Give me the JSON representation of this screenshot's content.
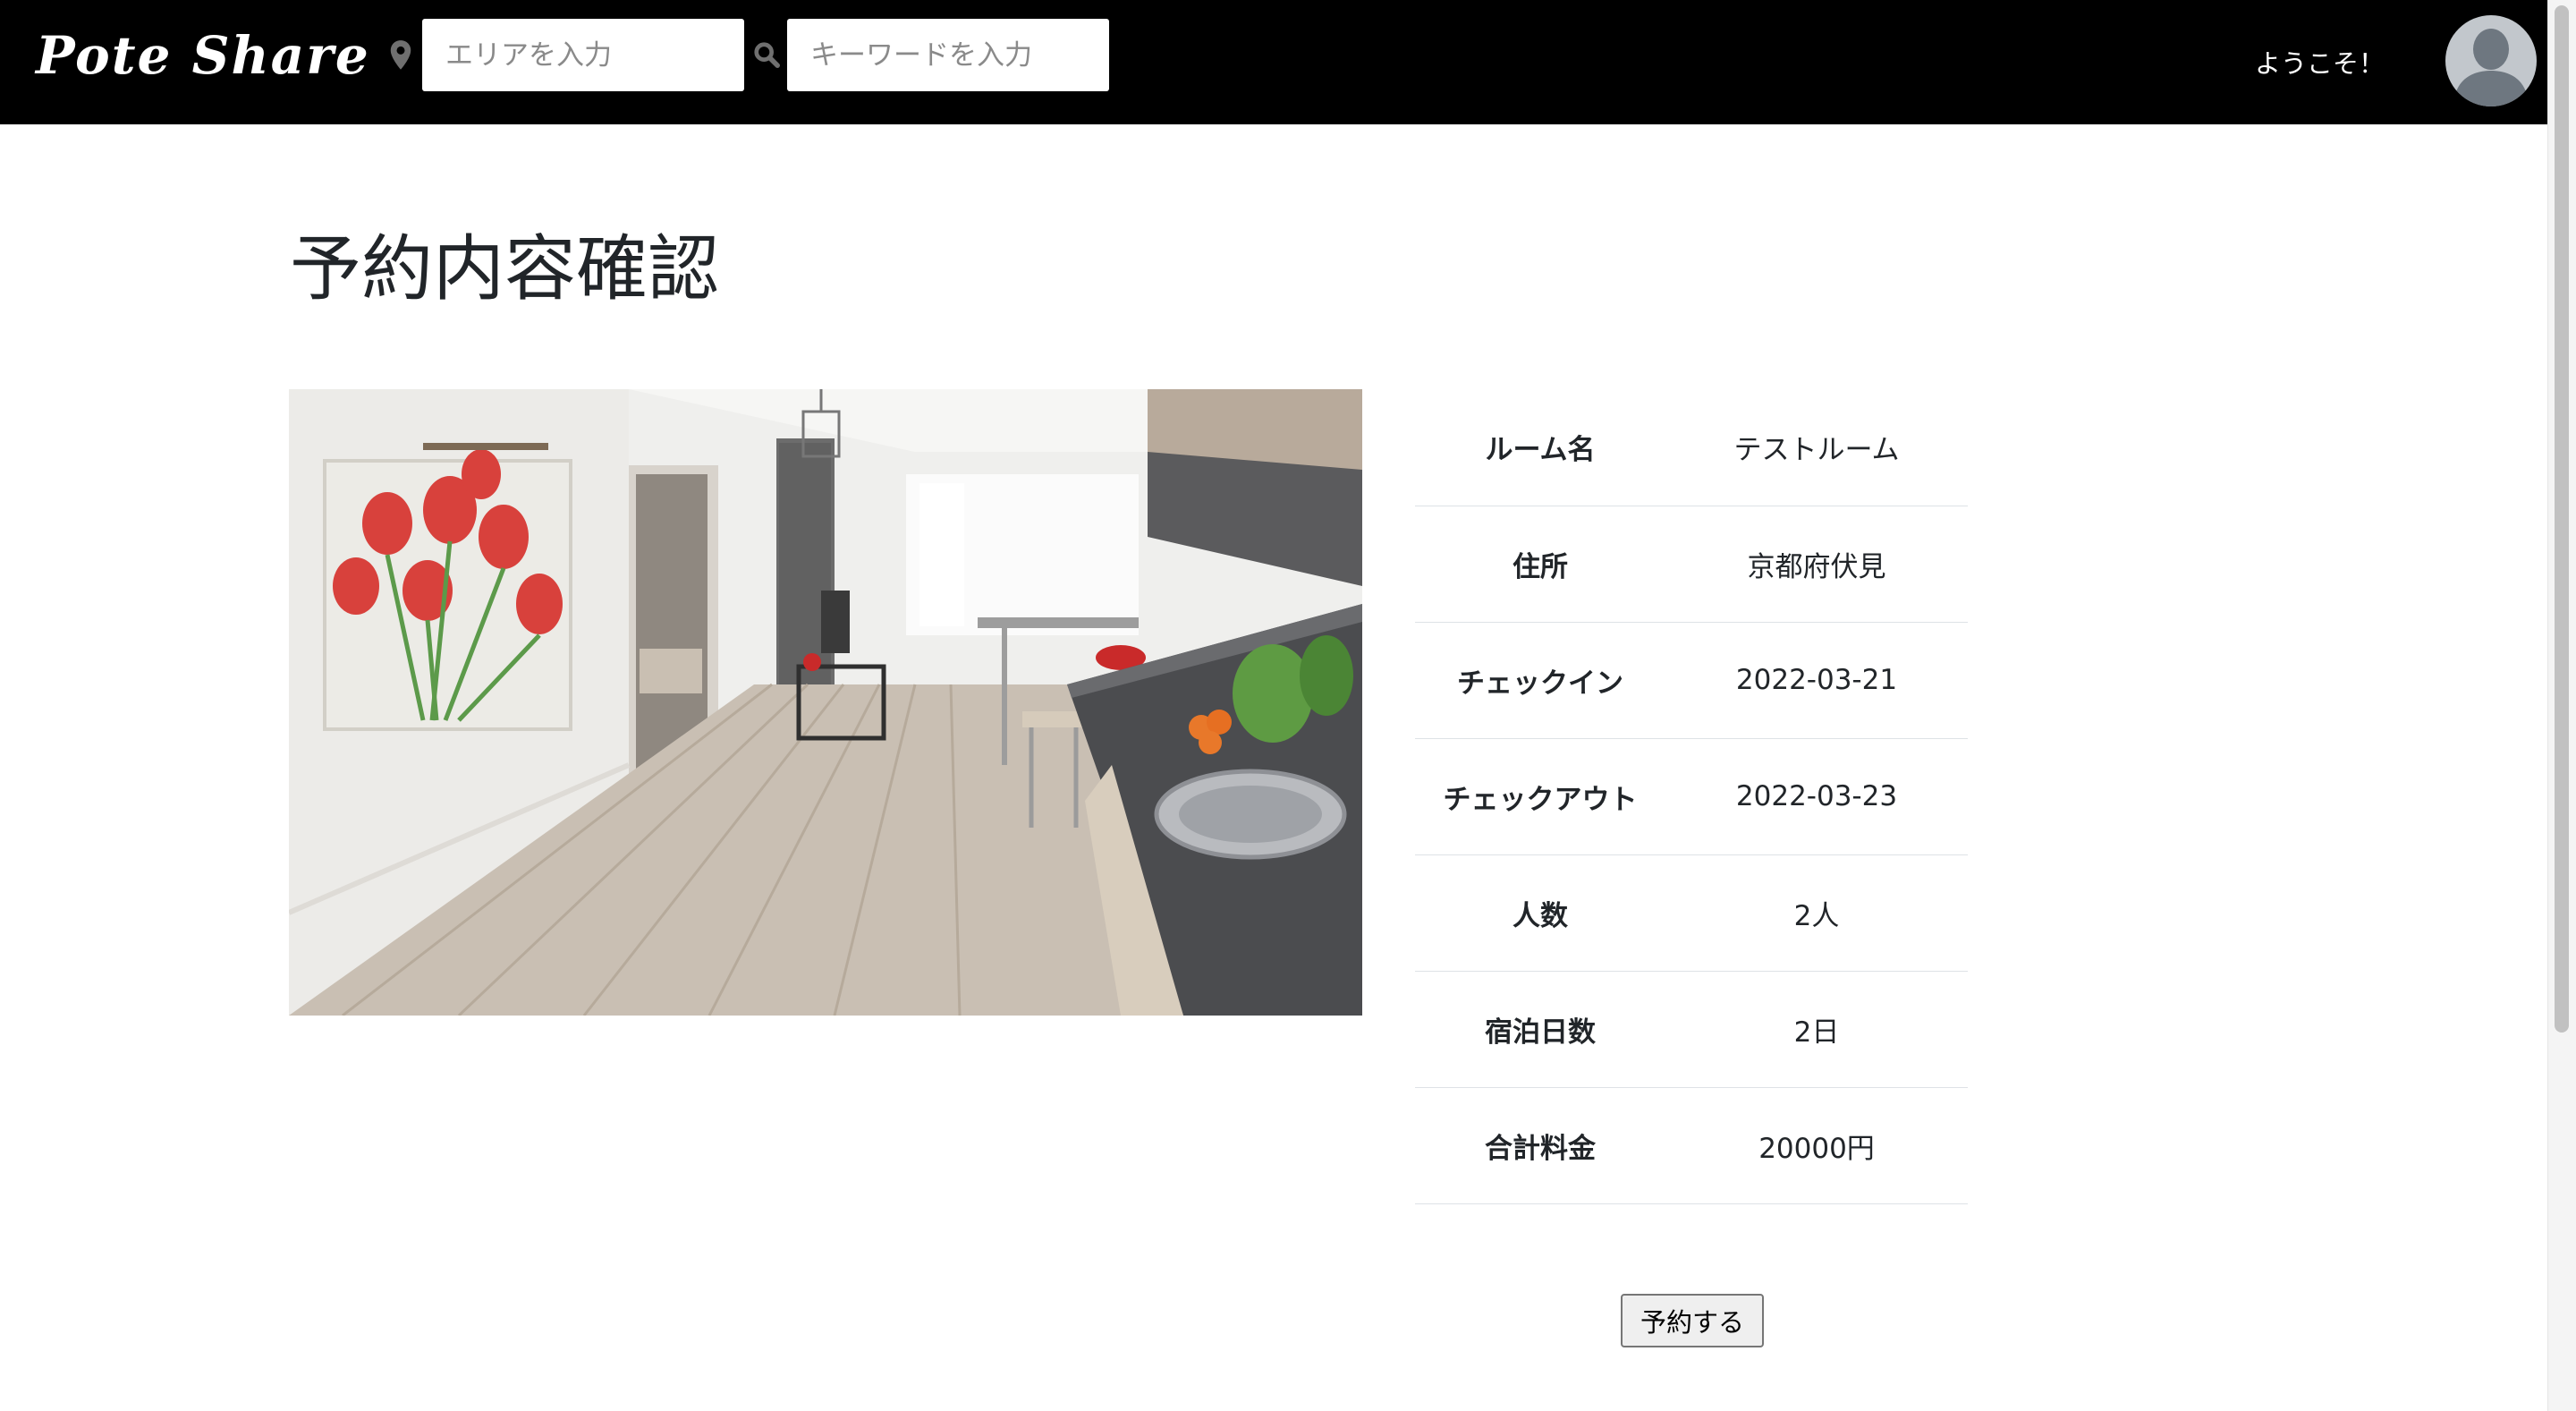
{
  "header": {
    "logo_text": "Pote Share",
    "area_icon": "map-marker-icon",
    "area_placeholder": "エリアを入力",
    "keyword_icon": "search-icon",
    "keyword_placeholder": "キーワードを入力",
    "welcome_text": "ようこそ！",
    "avatar_icon": "user-avatar-icon"
  },
  "page": {
    "title": "予約内容確認"
  },
  "room_photo": {
    "icon": "room-interior-photo"
  },
  "reservation": {
    "rows": [
      {
        "label": "ルーム名",
        "value": "テストルーム"
      },
      {
        "label": "住所",
        "value": "京都府伏見"
      },
      {
        "label": "チェックイン",
        "value": "2022-03-21"
      },
      {
        "label": "チェックアウト",
        "value": "2022-03-23"
      },
      {
        "label": "人数",
        "value": "2人"
      },
      {
        "label": "宿泊日数",
        "value": "2日"
      },
      {
        "label": "合計料金",
        "value": "20000円"
      }
    ],
    "submit_label": "予約する"
  },
  "colors": {
    "header_bg": "#000000",
    "text": "#212529",
    "row_border": "#dee2e6"
  }
}
